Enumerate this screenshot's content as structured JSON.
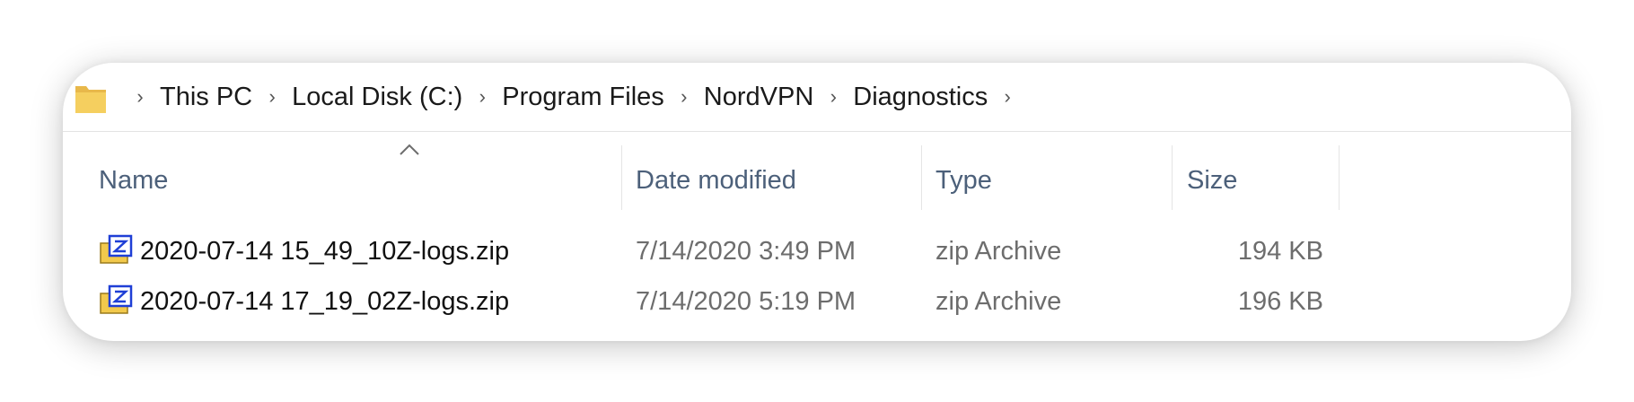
{
  "breadcrumb": {
    "items": [
      "This PC",
      "Local Disk (C:)",
      "Program Files",
      "NordVPN",
      "Diagnostics"
    ],
    "separator": "›",
    "folder_icon": "folder-icon",
    "folder_color": "#f5cf5f"
  },
  "columns": {
    "name": "Name",
    "date": "Date modified",
    "type": "Type",
    "size": "Size",
    "sort_indicator": "ascending"
  },
  "files": [
    {
      "name": "2020-07-14 15_49_10Z-logs.zip",
      "date": "7/14/2020 3:49 PM",
      "type": "zip Archive",
      "size": "194 KB",
      "icon": "zip-archive-icon"
    },
    {
      "name": "2020-07-14 17_19_02Z-logs.zip",
      "date": "7/14/2020 5:19 PM",
      "type": "zip Archive",
      "size": "196 KB",
      "icon": "zip-archive-icon"
    }
  ],
  "colors": {
    "header_text": "#4c607a",
    "secondary_text": "#6d6d6d",
    "zip_blue": "#1f3fd6"
  }
}
